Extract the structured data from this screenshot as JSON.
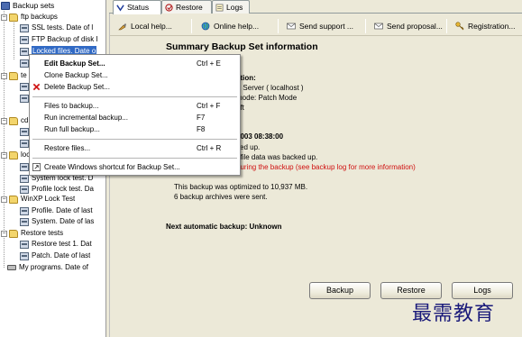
{
  "tree": {
    "root": "Backup sets",
    "items": [
      {
        "label": "ftp backups",
        "type": "folder"
      },
      {
        "label": "SSL tests. Date of l",
        "type": "set"
      },
      {
        "label": "FTP Backup of disk I",
        "type": "set"
      },
      {
        "label": "Locked files. Date o",
        "type": "set",
        "selected": true
      },
      {
        "label": "W",
        "type": "set"
      },
      {
        "label": "te",
        "type": "folder"
      },
      {
        "label": "",
        "type": "set"
      },
      {
        "label": "",
        "type": "set"
      },
      {
        "label": "cd",
        "type": "folder"
      },
      {
        "label": "",
        "type": "set"
      },
      {
        "label": "",
        "type": "set"
      },
      {
        "label": "loc",
        "type": "folder"
      },
      {
        "label": "",
        "type": "set"
      },
      {
        "label": "System lock test. D",
        "type": "set"
      },
      {
        "label": "Profile lock test. Da",
        "type": "set"
      },
      {
        "label": "WinXP Lock Test",
        "type": "folder"
      },
      {
        "label": "Profile. Date of last",
        "type": "set"
      },
      {
        "label": "System. Date of las",
        "type": "set"
      },
      {
        "label": "Restore tests",
        "type": "folder"
      },
      {
        "label": "Restore test 1. Dat",
        "type": "set"
      },
      {
        "label": "Patch. Date of last",
        "type": "set"
      },
      {
        "label": "My programs. Date of",
        "type": "drive"
      }
    ]
  },
  "tabs": [
    {
      "label": "Status",
      "active": true
    },
    {
      "label": "Restore",
      "active": false
    },
    {
      "label": "Logs",
      "active": false
    }
  ],
  "links": [
    {
      "label": "Local help..."
    },
    {
      "label": "Online help..."
    },
    {
      "label": "Send support ..."
    },
    {
      "label": "Send proposal..."
    },
    {
      "label": "Registration..."
    }
  ],
  "summary": {
    "title": "Summary Backup Set information",
    "frag_label": "ation:",
    "frag_server": "P Server ( localhost )",
    "frag_mode": "mode: Patch Mode",
    "frag_soft": "oft",
    "frag_date": "2003 08:38:00",
    "frag_backed": "ked up.",
    "frag_filedata": "f file data was backed up.",
    "frag_error": "during the backup (see backup log for more information)",
    "optimized": "This backup was optimized to 10,937 MB.",
    "archives": "6 backup archives were sent.",
    "next_backup": "Next automatic backup: Unknown"
  },
  "buttons": {
    "backup": "Backup",
    "restore": "Restore",
    "logs": "Logs"
  },
  "context_menu": {
    "items": [
      {
        "label": "Edit Backup Set...",
        "shortcut": "Ctrl + E",
        "bold": true
      },
      {
        "label": "Clone Backup Set...",
        "shortcut": ""
      },
      {
        "label": "Delete Backup Set...",
        "shortcut": "",
        "icon": "delete-icon"
      },
      {
        "label": "Files to backup...",
        "shortcut": "Ctrl + F"
      },
      {
        "label": "Run incremental backup...",
        "shortcut": "F7"
      },
      {
        "label": "Run full backup...",
        "shortcut": "F8"
      },
      {
        "label": "Restore files...",
        "shortcut": "Ctrl + R"
      },
      {
        "label": "Create Windows shortcut for Backup Set...",
        "shortcut": "",
        "icon": "shortcut-icon"
      }
    ]
  },
  "watermark": "最需教育",
  "colors": {
    "selection": "#316ac5",
    "error_text": "#d01010",
    "panel_bg": "#ece9d8"
  }
}
